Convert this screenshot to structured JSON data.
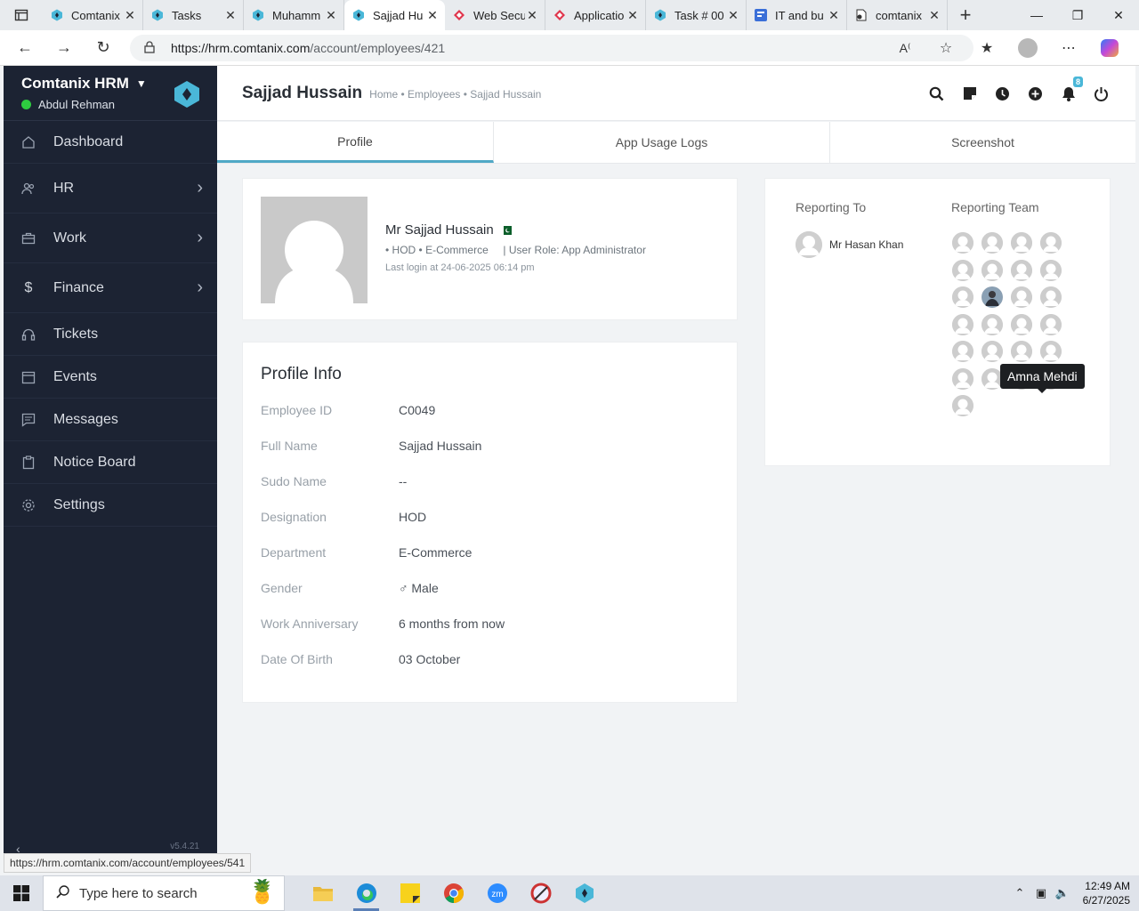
{
  "browser": {
    "tabs": [
      {
        "label": "Comtanix",
        "icon": "comtanix-icon",
        "active": false
      },
      {
        "label": "Tasks",
        "icon": "comtanix-icon",
        "active": false
      },
      {
        "label": "Muhamm",
        "icon": "comtanix-icon",
        "active": false
      },
      {
        "label": "Sajjad Hu",
        "icon": "comtanix-icon",
        "active": true
      },
      {
        "label": "Web Secu",
        "icon": "diamond-icon",
        "active": false
      },
      {
        "label": "Applicatio",
        "icon": "diamond-icon",
        "active": false
      },
      {
        "label": "Task # 00",
        "icon": "comtanix-icon",
        "active": false
      },
      {
        "label": "IT and bu",
        "icon": "form-icon",
        "active": false
      },
      {
        "label": "comtanix",
        "icon": "document-icon",
        "active": false
      }
    ],
    "url_domain": "https://hrm.comtanix.com",
    "url_path": "/account/employees/421",
    "status_url": "https://hrm.comtanix.com/account/employees/541"
  },
  "sidebar": {
    "brand": "Comtanix HRM",
    "user": "Abdul Rehman",
    "items": [
      {
        "label": "Dashboard",
        "icon": "home-icon",
        "submenu": false
      },
      {
        "label": "HR",
        "icon": "users-icon",
        "submenu": true
      },
      {
        "label": "Work",
        "icon": "briefcase-icon",
        "submenu": true
      },
      {
        "label": "Finance",
        "icon": "dollar-icon",
        "submenu": true
      },
      {
        "label": "Tickets",
        "icon": "headset-icon",
        "submenu": false
      },
      {
        "label": "Events",
        "icon": "calendar-icon",
        "submenu": false
      },
      {
        "label": "Messages",
        "icon": "message-icon",
        "submenu": false
      },
      {
        "label": "Notice Board",
        "icon": "clipboard-icon",
        "submenu": false
      },
      {
        "label": "Settings",
        "icon": "gear-icon",
        "submenu": false
      }
    ],
    "version": "v5.4.21"
  },
  "header": {
    "title": "Sajjad Hussain",
    "breadcrumb": "Home • Employees • Sajjad Hussain",
    "notification_count": "8"
  },
  "tabs": [
    "Profile",
    "App Usage Logs",
    "Screenshot"
  ],
  "profile": {
    "name": "Mr Sajjad Hussain",
    "meta": "• HOD • E-Commerce     | User Role: App Administrator",
    "last_login": "Last login at 24-06-2025 06:14 pm"
  },
  "profile_info": {
    "title": "Profile Info",
    "rows": [
      {
        "label": "Employee ID",
        "value": "C0049"
      },
      {
        "label": "Full Name",
        "value": "Sajjad Hussain"
      },
      {
        "label": "Sudo Name",
        "value": "--"
      },
      {
        "label": "Designation",
        "value": "HOD"
      },
      {
        "label": "Department",
        "value": "E-Commerce"
      },
      {
        "label": "Gender",
        "value": "♂ Male"
      },
      {
        "label": "Work Anniversary",
        "value": "6 months from now"
      },
      {
        "label": "Date Of Birth",
        "value": "03 October"
      }
    ]
  },
  "reporting": {
    "to_label": "Reporting To",
    "team_label": "Reporting Team",
    "manager": "Mr Hasan Khan",
    "team_count": 25,
    "tooltip": "Amna Mehdi"
  },
  "taskbar": {
    "search_placeholder": "Type here to search",
    "time": "12:49 AM",
    "date": "6/27/2025"
  },
  "colors": {
    "sidebar_bg": "#1c2333",
    "accent": "#4fa8c6",
    "online": "#2ecc40"
  }
}
